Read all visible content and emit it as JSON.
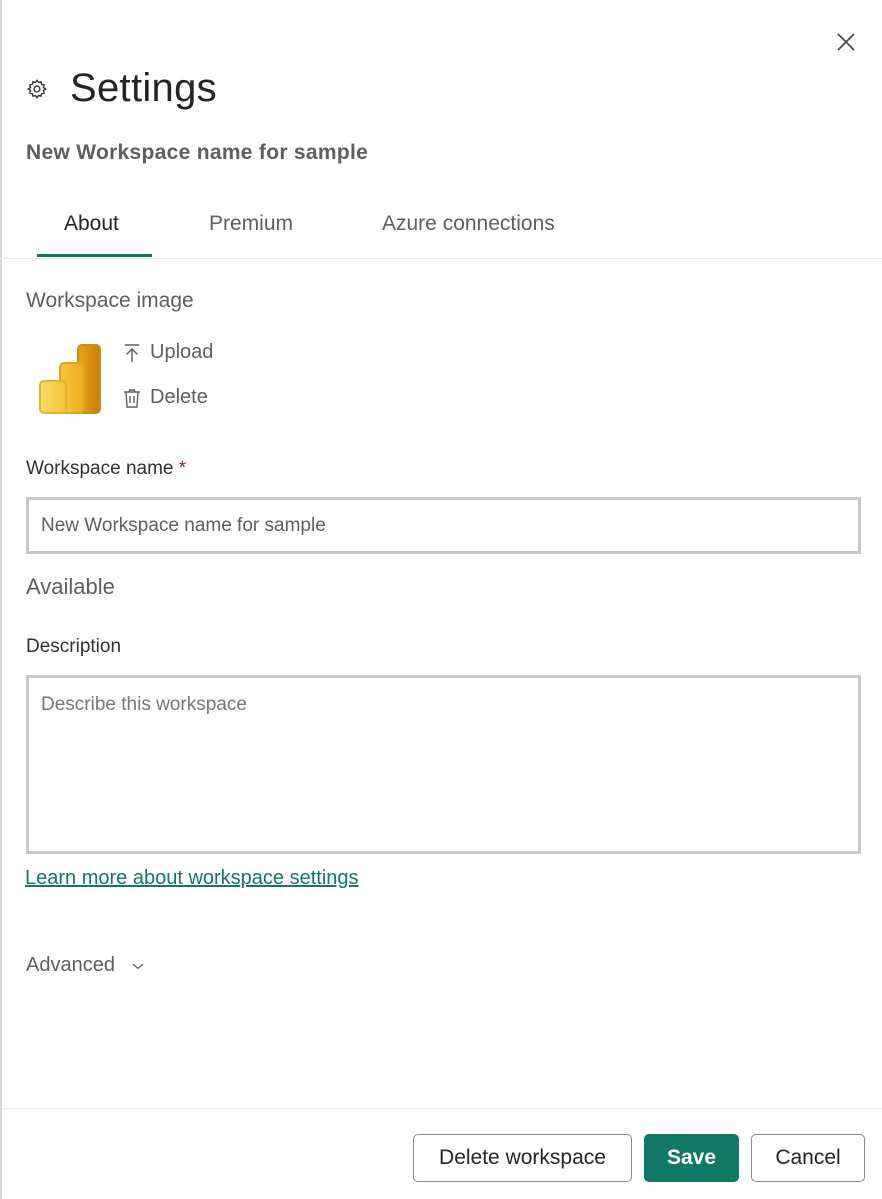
{
  "dialog": {
    "title": "Settings",
    "subtitle": "New Workspace name for sample",
    "close_label": "Close"
  },
  "tabs": [
    {
      "label": "About",
      "active": true
    },
    {
      "label": "Premium",
      "active": false
    },
    {
      "label": "Azure connections",
      "active": false
    }
  ],
  "about": {
    "workspace_image_label": "Workspace image",
    "upload_label": "Upload",
    "delete_label": "Delete",
    "workspace_name_label": "Workspace name",
    "required_marker": "*",
    "workspace_name_value": "New Workspace name for sample",
    "availability_status": "Available",
    "description_label": "Description",
    "description_placeholder": "Describe this workspace",
    "description_value": "",
    "learn_more_link": "Learn more about workspace settings",
    "advanced_label": "Advanced"
  },
  "footer": {
    "delete_workspace_label": "Delete workspace",
    "save_label": "Save",
    "cancel_label": "Cancel"
  },
  "colors": {
    "accent": "#117865",
    "required": "#a4262c"
  }
}
